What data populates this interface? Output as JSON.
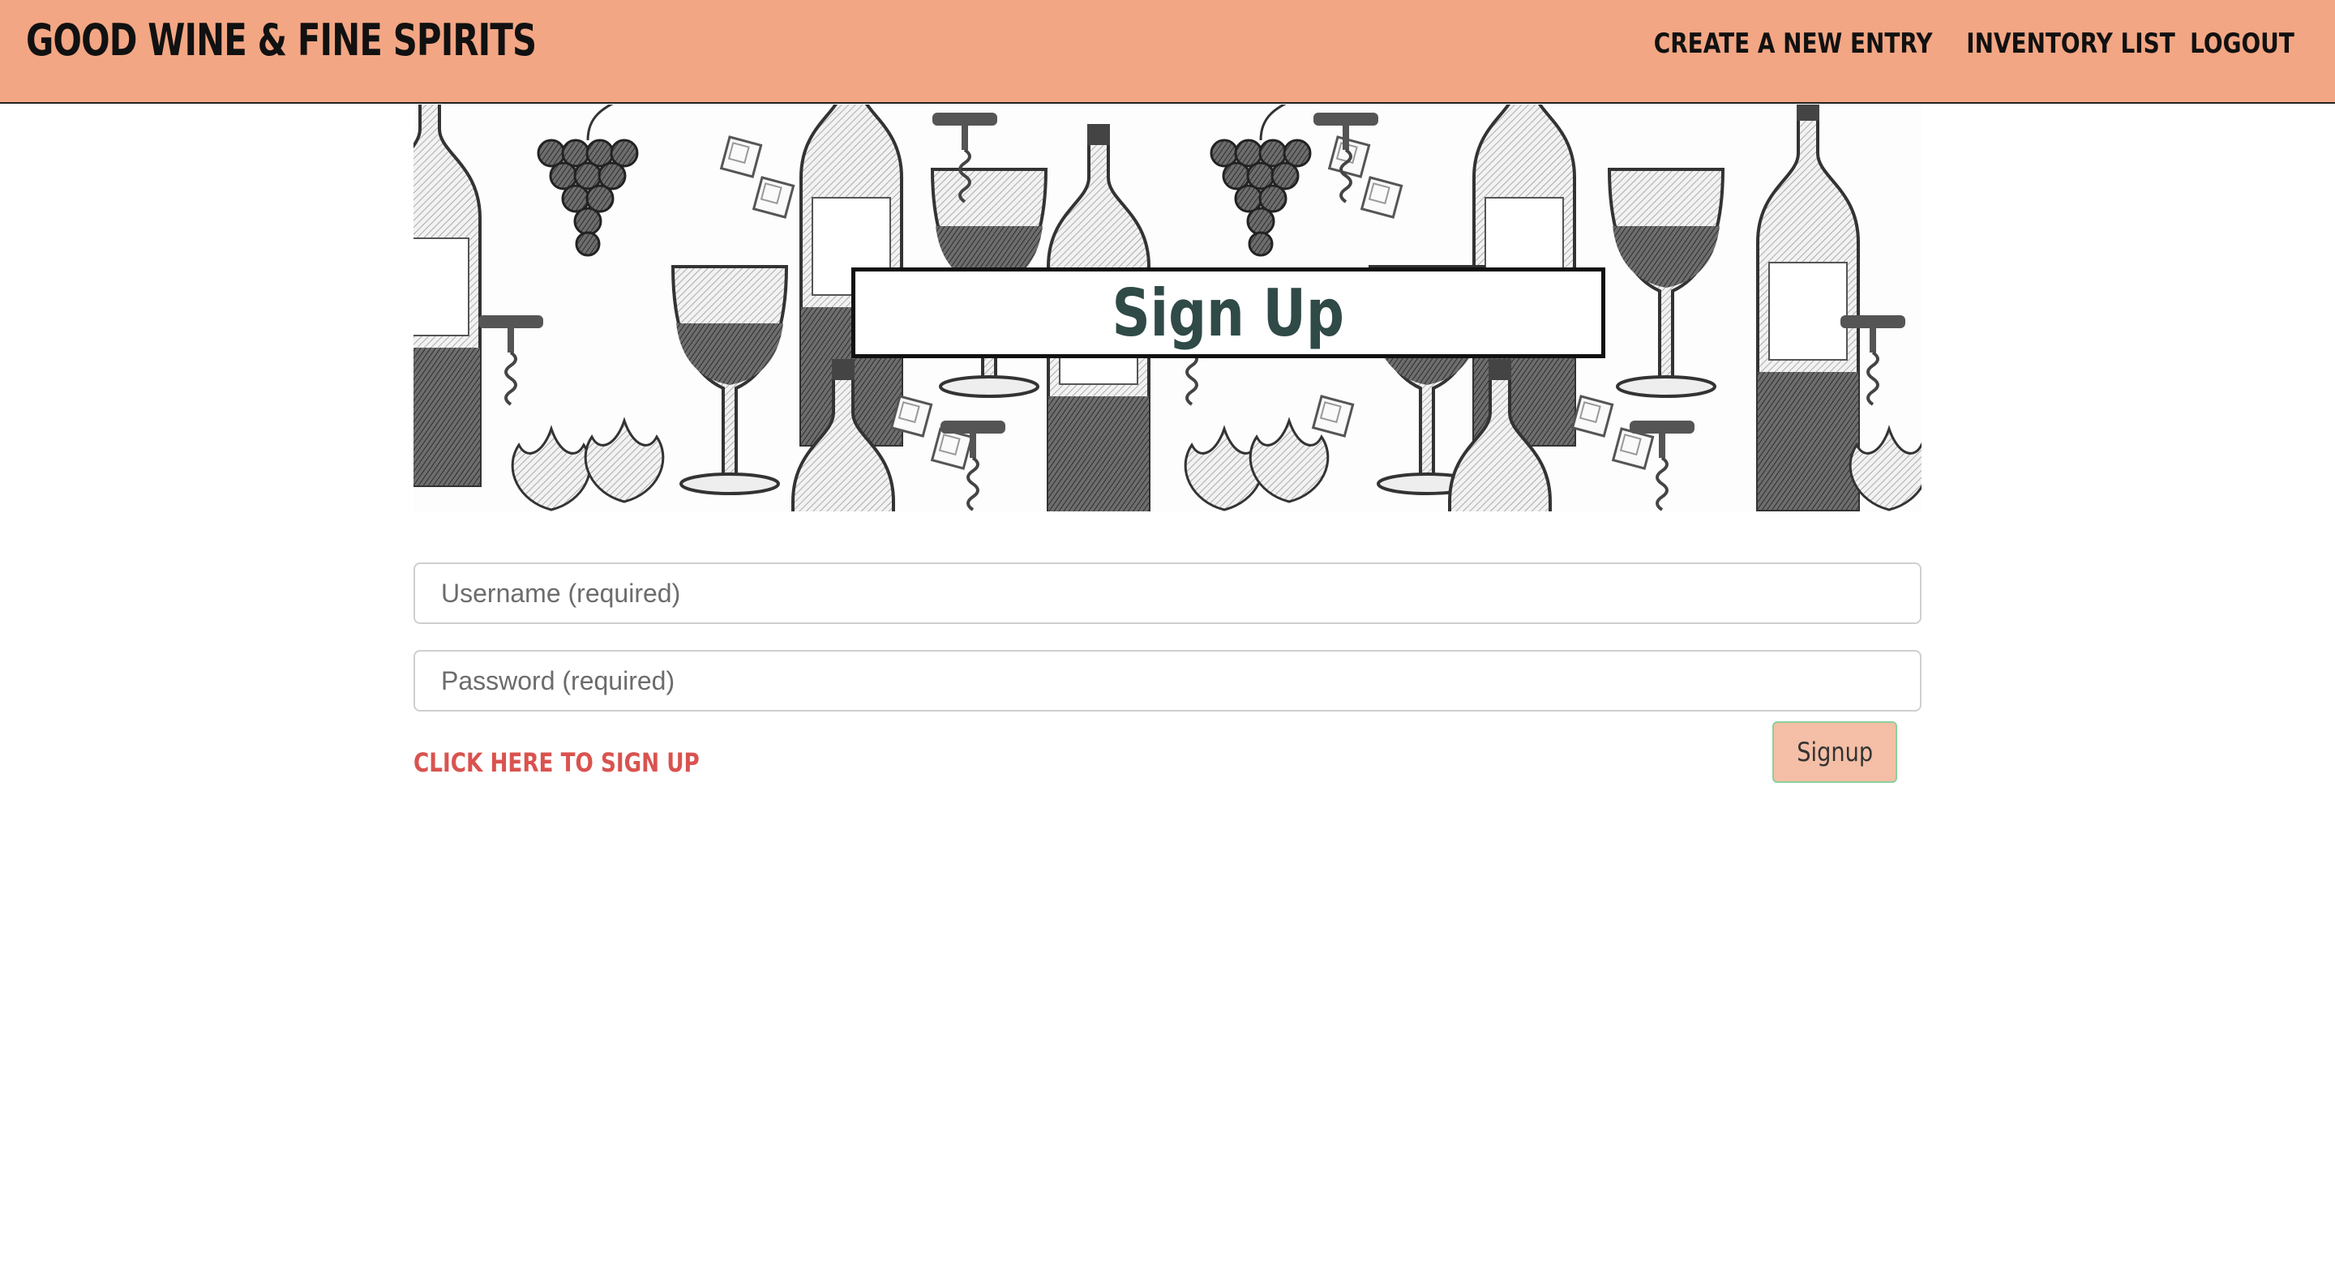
{
  "header": {
    "brand": "GOOD WINE & FINE SPIRITS",
    "nav": [
      "CREATE A NEW ENTRY",
      "INVENTORY LIST",
      "LOGOUT"
    ],
    "background_color": "#f3a683"
  },
  "hero": {
    "title": "Sign Up",
    "pattern_icons": [
      "wine-bottle-icon",
      "grapes-icon",
      "wine-glass-icon",
      "ice-cube-icon",
      "corkscrew-icon",
      "grape-leaf-icon"
    ]
  },
  "form": {
    "username_placeholder": "Username (required)",
    "password_placeholder": "Password (required)",
    "link_text": "CLICK HERE TO SIGN UP",
    "button_label": "Signup",
    "link_color": "#d9534f",
    "button_color": "#f4bfa6"
  }
}
